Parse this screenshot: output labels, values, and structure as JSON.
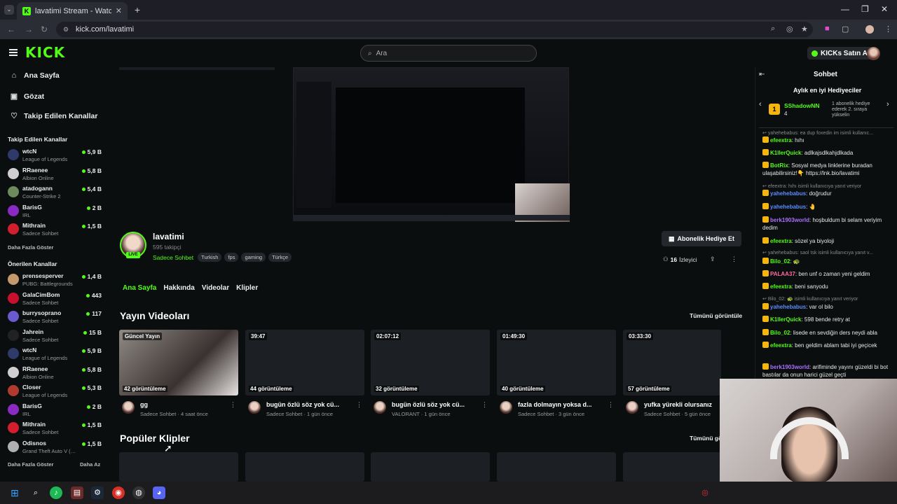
{
  "browser": {
    "tab_title": "lavatimi Stream - Watch Live on Kick",
    "tab_close": "✕",
    "new_tab": "+",
    "url": "kick.com/lavatimi",
    "window_controls": [
      "—",
      "❐",
      "✕"
    ]
  },
  "header": {
    "logo": "KICK",
    "search_placeholder": "Ara",
    "buy_kicks": "KICKs Satın Al"
  },
  "sidebar": {
    "nav": [
      {
        "label": "Ana Sayfa",
        "icon": "home-icon"
      },
      {
        "label": "Gözat",
        "icon": "browse-icon"
      },
      {
        "label": "Takip Edilen Kanallar",
        "icon": "heart-icon"
      }
    ],
    "followed_title": "Takip Edilen Kanallar",
    "followed": [
      {
        "name": "wtcN",
        "category": "League of Legends",
        "viewers": "5,9 B",
        "color": "#2f3a6b"
      },
      {
        "name": "RRaenee",
        "category": "Albion Online",
        "viewers": "5,8 B",
        "color": "#cfcfcf"
      },
      {
        "name": "atadogann",
        "category": "Counter-Strike 2",
        "viewers": "5,4 B",
        "color": "#6c8a5c"
      },
      {
        "name": "BarisG",
        "category": "IRL",
        "viewers": "2 B",
        "color": "#8a2ac2"
      },
      {
        "name": "Mithrain",
        "category": "Sadece Sohbet",
        "viewers": "1,5 B",
        "color": "#d31e2d"
      }
    ],
    "more1": "Daha Fazla Göster",
    "recommended_title": "Önerilen Kanallar",
    "recommended": [
      {
        "name": "prensesperver",
        "category": "PUBG: Battlegrounds",
        "viewers": "1,4 B",
        "color": "#c49a6c"
      },
      {
        "name": "GalaCimBom",
        "category": "Sadece Sohbet",
        "viewers": "443",
        "color": "#c8102e"
      },
      {
        "name": "burrysoprano",
        "category": "Sadece Sohbet",
        "viewers": "117",
        "color": "#6a5acd"
      },
      {
        "name": "Jahrein",
        "category": "Sadece Sohbet",
        "viewers": "15 B",
        "color": "#222222"
      },
      {
        "name": "wtcN",
        "category": "League of Legends",
        "viewers": "5,9 B",
        "color": "#2f3a6b"
      },
      {
        "name": "RRaenee",
        "category": "Albion Online",
        "viewers": "5,8 B",
        "color": "#cfcfcf"
      },
      {
        "name": "Closer",
        "category": "League of Legends",
        "viewers": "5,3 B",
        "color": "#b03a2e"
      },
      {
        "name": "BarisG",
        "category": "IRL",
        "viewers": "2 B",
        "color": "#8a2ac2"
      },
      {
        "name": "Mithrain",
        "category": "Sadece Sohbet",
        "viewers": "1,5 B",
        "color": "#d31e2d"
      },
      {
        "name": "Odisnos",
        "category": "Grand Theft Auto V (…",
        "viewers": "1,5 B",
        "color": "#b0b0b0"
      }
    ],
    "more2": "Daha Fazla Göster",
    "less": "Daha Az"
  },
  "channel": {
    "name": "lavatimi",
    "followers": "595 takipçi",
    "live": "LIVE",
    "category": "Sadece Sohbet",
    "tags": [
      "Turkish",
      "fps",
      "gaming",
      "Türkçe"
    ],
    "gift_button": "Abonelik Hediye Et",
    "viewers_count": "16",
    "viewers_label": "İzleyici",
    "tabs": [
      "Ana Sayfa",
      "Hakkında",
      "Videolar",
      "Klipler"
    ]
  },
  "videos": {
    "title": "Yayın Videoları",
    "see_all": "Tümünü görüntüle",
    "items": [
      {
        "badge": "Güncel Yayın",
        "views": "42 görüntüleme",
        "title": "gg",
        "meta": "Sadece Sohbet · 4 saat önce"
      },
      {
        "badge": "39:47",
        "views": "44 görüntüleme",
        "title": "bugün özlü söz yok cü...",
        "meta": "Sadece Sohbet · 1 gün önce"
      },
      {
        "badge": "02:07:12",
        "views": "32 görüntüleme",
        "title": "bugün özlü söz yok cü...",
        "meta": "VALORANT · 1 gün önce"
      },
      {
        "badge": "01:49:30",
        "views": "40 görüntüleme",
        "title": "fazla dolmayın yoksa d...",
        "meta": "Sadece Sohbet · 3 gün önce"
      },
      {
        "badge": "03:33:30",
        "views": "57 görüntüleme",
        "title": "yufka yürekli olursanız",
        "meta": "Sadece Sohbet · 5 gün önce"
      }
    ]
  },
  "clips": {
    "title": "Popüler Klipler",
    "see_all": "Tümünü gö"
  },
  "chat": {
    "title": "Sohbet",
    "top_gifters": "Aylık en iyi Hediyeciler",
    "gifter_rank": "1",
    "gifter_name": "SShadowNN",
    "gifter_count": "4",
    "gifter_note": "1 abonelik hediye ederek 2. sıraya yükselin",
    "messages": [
      {
        "type": "reply",
        "text": "yahehebabus: ea dup  foxedin im isimli kullanıc..."
      },
      {
        "user": "efeextra",
        "color": "#53fc18",
        "text": "hıhı"
      },
      {
        "user": "K1llerQuick",
        "color": "#53fc18",
        "text": "adlkajsdlkahjdlkada"
      },
      {
        "user": "BotRix",
        "color": "#53fc18",
        "text": "Sosyal medya linklerine buradan ulaşabilirsiniz!👇 https://lnk.bio/lavatimi"
      },
      {
        "type": "reply",
        "text": "efeextra: hıhı isimli kullanıcıya yanıt veriyor"
      },
      {
        "user": "yahehebabus",
        "color": "#5b8cff",
        "text": "doğrudur"
      },
      {
        "user": "yahehebabus",
        "color": "#5b8cff",
        "text": "🤚"
      },
      {
        "user": "berk1903world",
        "color": "#a970ff",
        "text": "hoşbuldum bi selam veriyim dedim"
      },
      {
        "user": "efeextra",
        "color": "#53fc18",
        "text": "sözel ya biyoloji"
      },
      {
        "type": "reply",
        "text": "yahehebabus: saol tsk isimli kullanıcıya yanıt v..."
      },
      {
        "user": "Bilo_02",
        "color": "#53fc18",
        "text": "🐢"
      },
      {
        "user": "PALAA37",
        "color": "#ff6b9a",
        "text": "ben unf o zaman yeni geldim"
      },
      {
        "user": "efeextra",
        "color": "#53fc18",
        "text": "beni sanyodu"
      },
      {
        "type": "reply",
        "text": "Bilo_02: 🐢 isimli kullanıcıya yanıt veriyor"
      },
      {
        "user": "yahehebabus",
        "color": "#5b8cff",
        "text": "var ol bilo"
      },
      {
        "user": "K1llerQuick",
        "color": "#53fc18",
        "text": "598 bende retry at"
      },
      {
        "user": "Bilo_02",
        "color": "#53fc18",
        "text": "lisede en sevdiğin ders neydi abla"
      },
      {
        "user": "efeextra",
        "color": "#53fc18",
        "text": "ben geldim ablam tabi iyi geçicek"
      },
      {
        "user": "berk1903world",
        "color": "#a970ff",
        "text": "arifiminde yayını güzeldi bi bot bastılar da onun harici güzel geçti"
      }
    ]
  },
  "colors": {
    "accent": "#53fc18",
    "bg": "#0b0e0f"
  }
}
